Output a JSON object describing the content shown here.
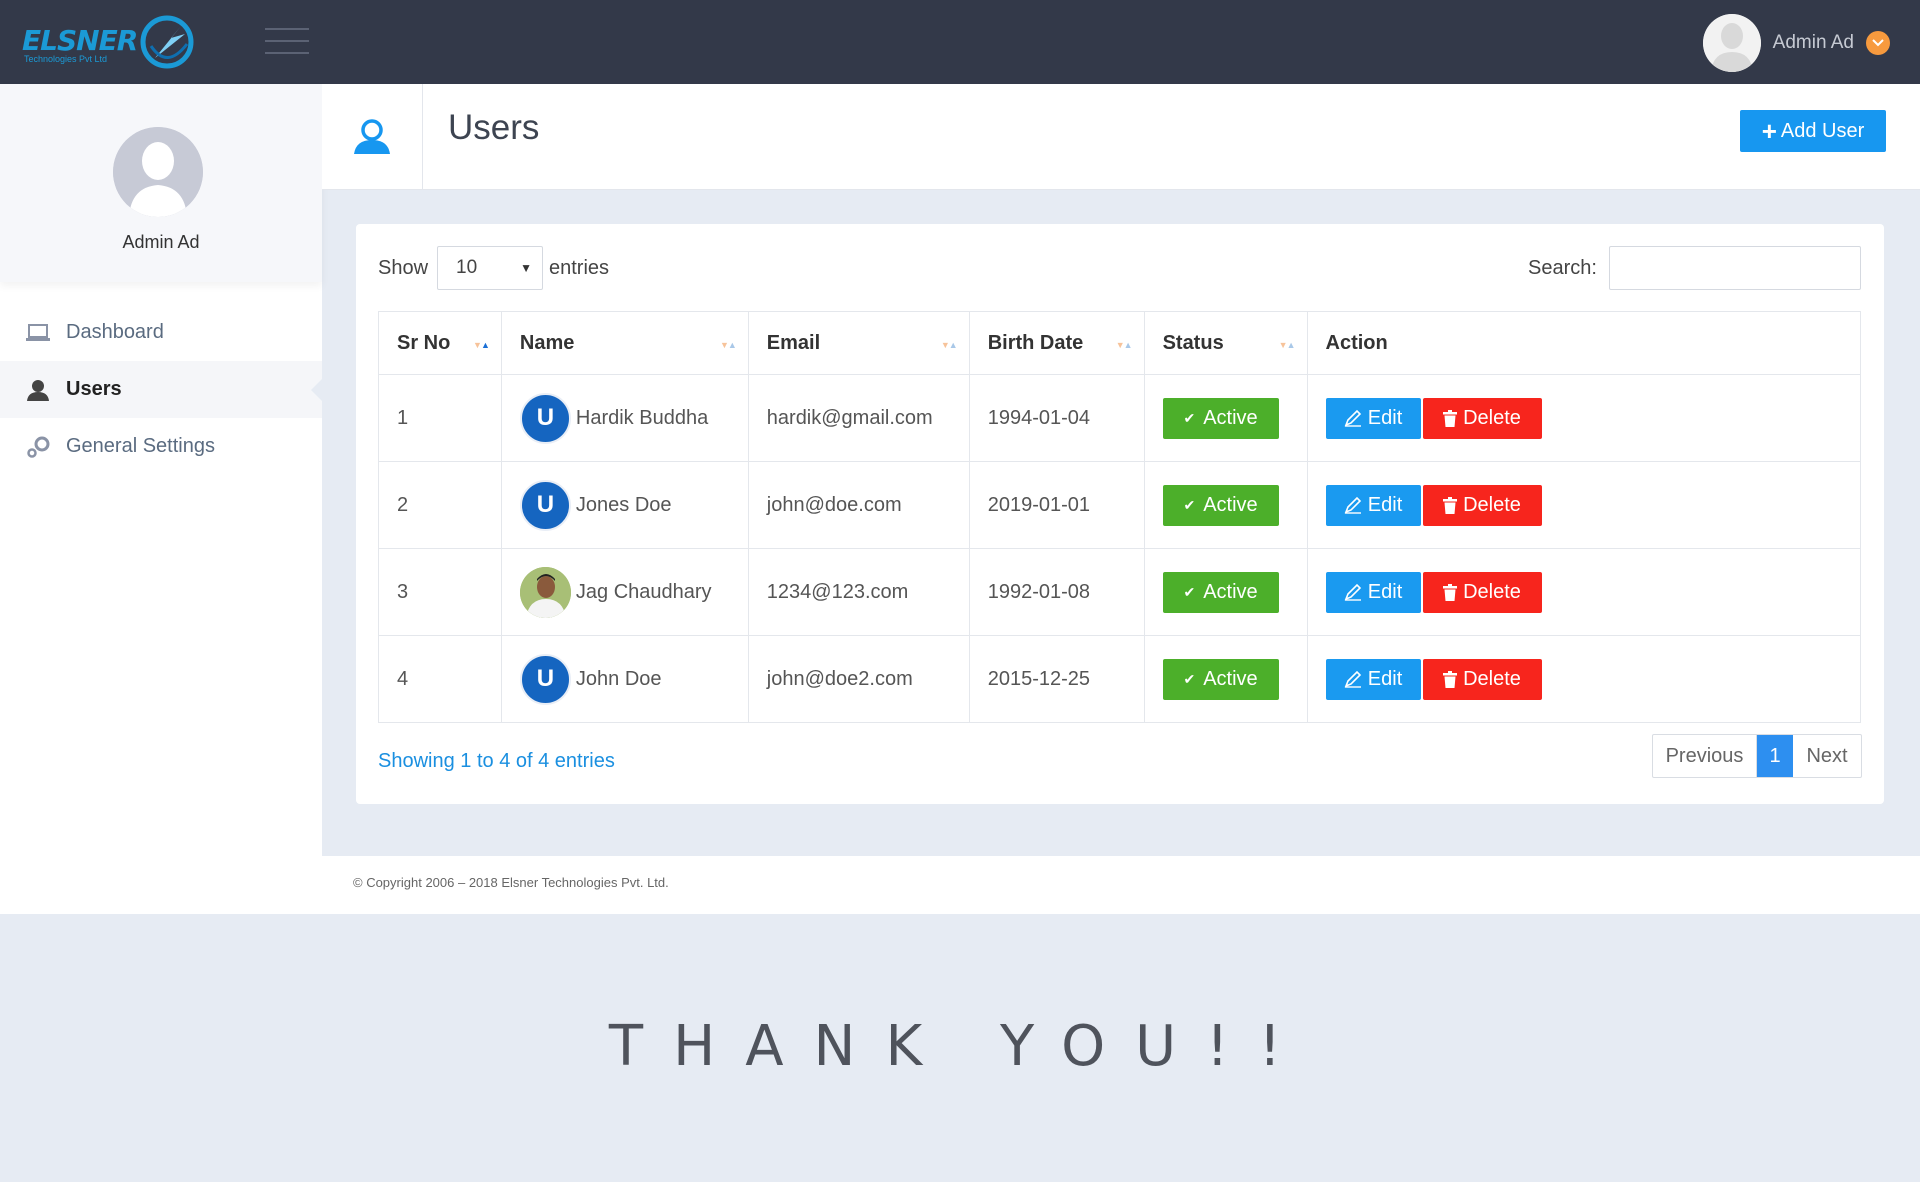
{
  "brand": {
    "name": "ELSNER",
    "tagline": "Technologies Pvt Ltd",
    "color": "#1b9ad6"
  },
  "topbar": {
    "user_name": "Admin Ad",
    "menu_icon": "hamburger-icon",
    "caret_icon": "chevron-down-icon"
  },
  "sidebar": {
    "profile_name": "Admin Ad",
    "items": [
      {
        "label": "Dashboard",
        "icon": "laptop-icon",
        "active": false
      },
      {
        "label": "Users",
        "icon": "user-icon",
        "active": true
      },
      {
        "label": "General Settings",
        "icon": "gears-icon",
        "active": false
      }
    ]
  },
  "page": {
    "title": "Users",
    "add_button": "Add User",
    "accent": "#1797f0"
  },
  "table_controls": {
    "show_label": "Show",
    "page_length": "10",
    "entries_label": "entries",
    "search_label": "Search:"
  },
  "table": {
    "headers": [
      "Sr No",
      "Name",
      "Email",
      "Birth Date",
      "Status",
      "Action"
    ],
    "rows": [
      {
        "sr": "1",
        "avatar": "U",
        "name": "Hardik Buddha",
        "email": "hardik@gmail.com",
        "birth": "1994-01-04",
        "status": "Active"
      },
      {
        "sr": "2",
        "avatar": "U",
        "name": "Jones Doe",
        "email": "john@doe.com",
        "birth": "2019-01-01",
        "status": "Active"
      },
      {
        "sr": "3",
        "avatar": "photo",
        "name": "Jag Chaudhary",
        "email": "1234@123.com",
        "birth": "1992-01-08",
        "status": "Active"
      },
      {
        "sr": "4",
        "avatar": "U",
        "name": "John Doe",
        "email": "john@doe2.com",
        "birth": "2015-12-25",
        "status": "Active"
      }
    ],
    "edit_label": "Edit",
    "delete_label": "Delete",
    "status_color": "#4caf2a",
    "edit_color": "#1a9af0",
    "delete_color": "#f7251d"
  },
  "pagination": {
    "info": "Showing 1 to 4 of 4 entries",
    "previous": "Previous",
    "current": "1",
    "next": "Next"
  },
  "footer": {
    "copyright": "© Copyright 2006 – 2018 Elsner Technologies Pvt. Ltd."
  },
  "closing": {
    "text": "THANK YOU!!"
  }
}
